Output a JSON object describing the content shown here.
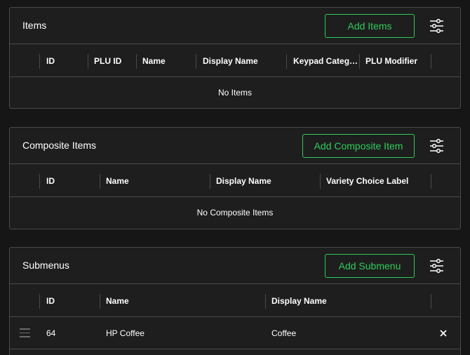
{
  "items_section": {
    "title": "Items",
    "add_label": "Add Items",
    "columns": [
      "ID",
      "PLU ID",
      "Name",
      "Display Name",
      "Keypad Categ…",
      "PLU Modifier"
    ],
    "empty_text": "No Items"
  },
  "composite_section": {
    "title": "Composite Items",
    "add_label": "Add Composite Item",
    "columns": [
      "ID",
      "Name",
      "Display Name",
      "Variety Choice Label"
    ],
    "empty_text": "No Composite Items"
  },
  "submenus_section": {
    "title": "Submenus",
    "add_label": "Add Submenu",
    "columns": [
      "ID",
      "Name",
      "Display Name"
    ],
    "rows": [
      {
        "id": "64",
        "name": "HP Coffee",
        "display_name": "Coffee"
      }
    ]
  },
  "icons": {
    "settings": "sliders-icon",
    "drag": "drag-handle-icon",
    "remove": "close-icon"
  },
  "colors": {
    "background": "#161616",
    "card": "#1e1e1e",
    "border": "#4a4a4a",
    "accent": "#2ecc5a"
  }
}
